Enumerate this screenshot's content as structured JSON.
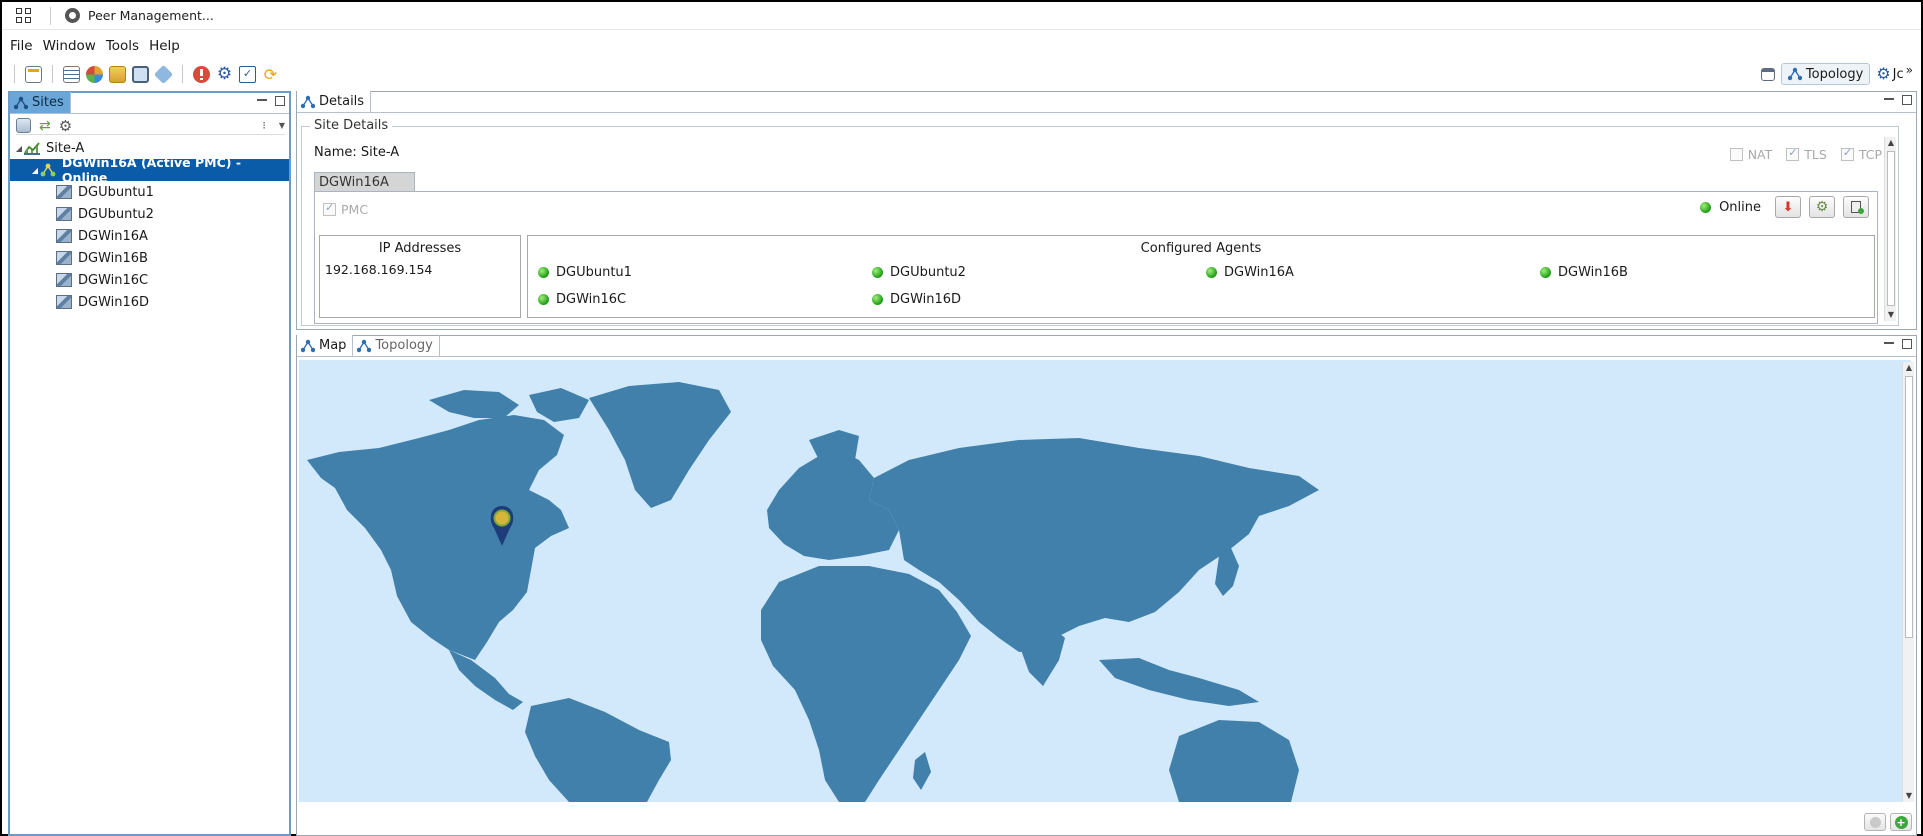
{
  "window": {
    "title": "Peer Management..."
  },
  "menu": {
    "items": [
      "File",
      "Window",
      "Tools",
      "Help"
    ]
  },
  "toolbar": {
    "icons": [
      "new-window-icon",
      "list-icon",
      "colors-icon",
      "folders-icon",
      "monitor-icon",
      "tag-icon",
      "stop-icon",
      "gear-icon",
      "clipboard-check-icon",
      "refresh-icon"
    ],
    "right": {
      "topology_label": "Topology",
      "overflow_label": "Jc"
    }
  },
  "sites_panel": {
    "tab_label": "Sites",
    "tree": [
      {
        "label": "Site-A",
        "level": 0,
        "expanded": true,
        "selected": false,
        "icon": "site-icon"
      },
      {
        "label": "DGWin16A (Active PMC) - Online",
        "level": 1,
        "expanded": true,
        "selected": true,
        "icon": "topology-icon"
      },
      {
        "label": "DGUbuntu1",
        "level": 2,
        "selected": false,
        "icon": "agent-icon"
      },
      {
        "label": "DGUbuntu2",
        "level": 2,
        "selected": false,
        "icon": "agent-icon"
      },
      {
        "label": "DGWin16A",
        "level": 2,
        "selected": false,
        "icon": "agent-icon"
      },
      {
        "label": "DGWin16B",
        "level": 2,
        "selected": false,
        "icon": "agent-icon"
      },
      {
        "label": "DGWin16C",
        "level": 2,
        "selected": false,
        "icon": "agent-icon"
      },
      {
        "label": "DGWin16D",
        "level": 2,
        "selected": false,
        "icon": "agent-icon"
      }
    ]
  },
  "details_panel": {
    "tab_label": "Details",
    "group_title": "Site Details",
    "name_line": "Name: Site-A",
    "options": [
      {
        "label": "NAT",
        "checked": false
      },
      {
        "label": "TLS",
        "checked": true
      },
      {
        "label": "TCP",
        "checked": true
      }
    ],
    "subtab_label": "DGWin16A",
    "pmc_label": "PMC",
    "status_label": "Online",
    "ip_header": "IP Addresses",
    "ip_value": "192.168.169.154",
    "agents_header": "Configured Agents",
    "agents": [
      "DGUbuntu1",
      "DGUbuntu2",
      "DGWin16A",
      "DGWin16B",
      "DGWin16C",
      "DGWin16D"
    ]
  },
  "map_panel": {
    "tabs": [
      {
        "label": "Map",
        "active": true
      },
      {
        "label": "Topology",
        "active": false
      }
    ],
    "colors": {
      "ocean": "#d2e9fb",
      "land": "#4180ab",
      "pin": "#1f3c7a",
      "pin_dot": "#d7b43a"
    }
  }
}
